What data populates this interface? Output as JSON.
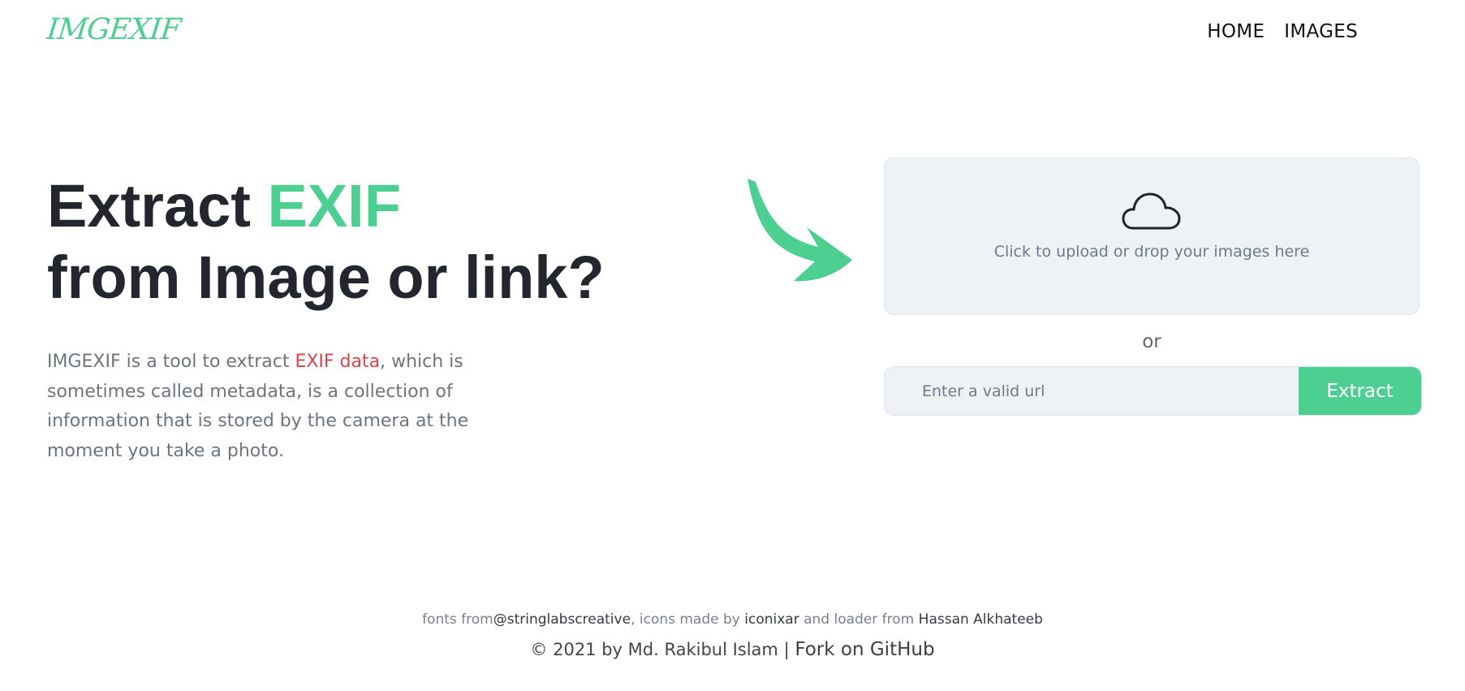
{
  "header": {
    "logo": "IMGEXIF",
    "nav": [
      "HOME",
      "IMAGES"
    ]
  },
  "hero": {
    "title_part1": "Extract ",
    "title_accent": "EXIF",
    "title_part2": "from Image or link?",
    "desc_before": "IMGEXIF is a tool to extract ",
    "desc_link": "EXIF data",
    "desc_after": ", which is sometimes called metadata, is a collection of information that is stored by the camera at the moment you take a photo."
  },
  "upload": {
    "hint": "Click to upload or drop your images here",
    "icon": "cloud-upload-icon",
    "or": "or",
    "url_placeholder": "Enter a valid url",
    "extract_label": "Extract"
  },
  "footer": {
    "fonts_text": "fonts from",
    "fonts_link": "@stringlabscreative",
    "icons_text": ", icons made by ",
    "icons_link": "iconixar",
    "loader_text": " and loader from ",
    "loader_link": "Hassan Alkhateeb",
    "copyright": "© 2021 by Md. Rakibul Islam",
    "separator": " | ",
    "fork": "Fork on GitHub"
  },
  "colors": {
    "accent": "#4ccf91",
    "link_red": "#d9434f",
    "dropzone_bg": "#eff2f5"
  }
}
